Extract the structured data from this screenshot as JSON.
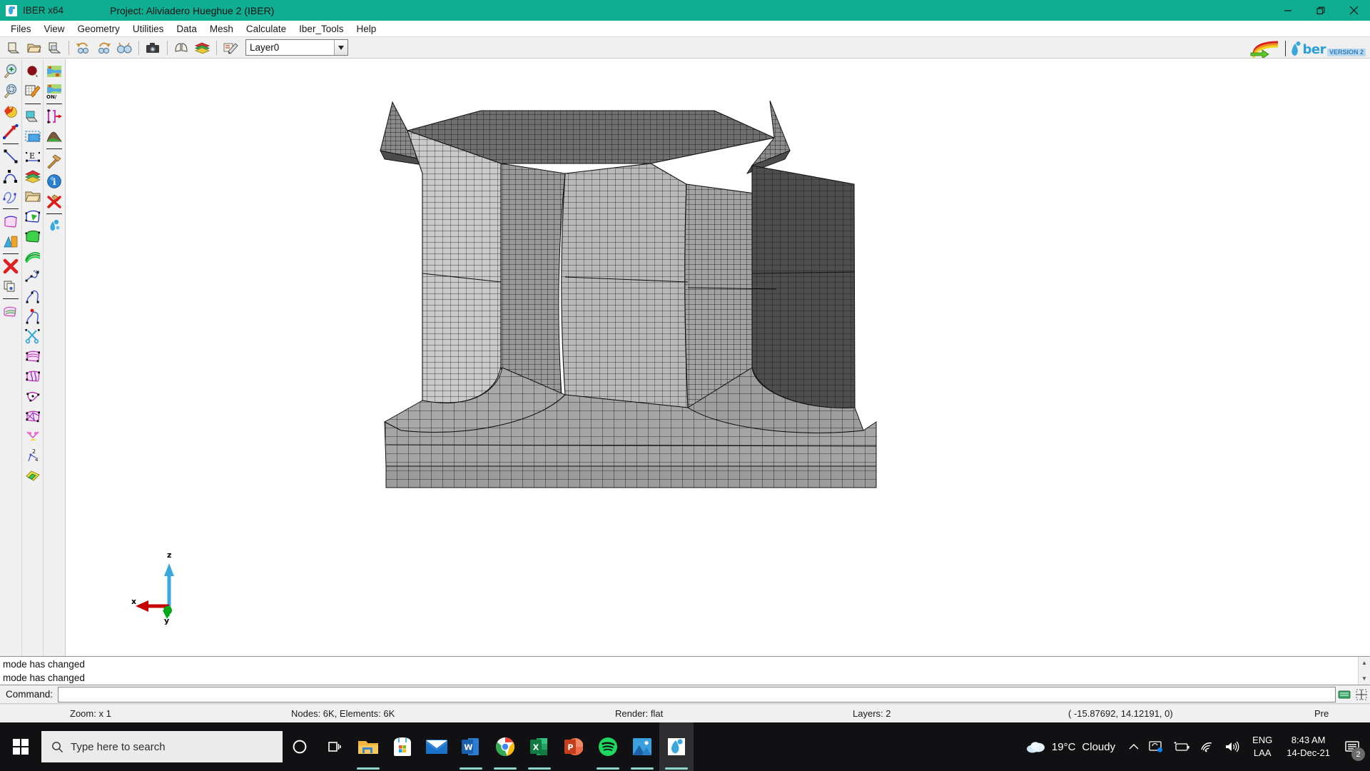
{
  "window": {
    "app_title": "IBER x64",
    "project_title": "Project: Aliviadero Hueghue 2 (IBER)",
    "minimize_label": "—",
    "maximize_label": "❐",
    "close_label": "✕",
    "titlebar_color": "#0fae93"
  },
  "menubar": {
    "items": [
      {
        "label": "Files"
      },
      {
        "label": "View"
      },
      {
        "label": "Geometry"
      },
      {
        "label": "Utilities"
      },
      {
        "label": "Data"
      },
      {
        "label": "Mesh"
      },
      {
        "label": "Calculate"
      },
      {
        "label": "Iber_Tools"
      },
      {
        "label": "Help"
      }
    ]
  },
  "toolbar": {
    "buttons": [
      {
        "name": "new-file-icon",
        "glyph": "◰"
      },
      {
        "name": "open-folder-icon",
        "glyph": "◱"
      },
      {
        "name": "save-disk-icon",
        "glyph": "▣"
      },
      {
        "name": "undo-icon",
        "glyph": "↶"
      },
      {
        "name": "redo-icon",
        "glyph": "↷"
      },
      {
        "name": "glasses-view-icon",
        "glyph": "⦿"
      },
      {
        "name": "camera-snapshot-icon",
        "glyph": "■"
      },
      {
        "name": "pages-icon",
        "glyph": "❐"
      },
      {
        "name": "layers-books-icon",
        "glyph": "☰"
      },
      {
        "name": "edit-pencil-icon",
        "glyph": "✎"
      }
    ],
    "layer_combo": {
      "value": "Layer0",
      "arrow": "▼"
    },
    "logo": {
      "rainbow_arrow": "rainbow-arrow-icon",
      "brand": "ber",
      "version": "VERSION 2"
    }
  },
  "sidebar": {
    "column1": [
      {
        "name": "zoom-in-icon"
      },
      {
        "name": "zoom-frame-icon"
      },
      {
        "name": "rotate-sphere-icon"
      },
      {
        "name": "arrow-point-icon"
      },
      {
        "sep": true
      },
      {
        "name": "line-icon"
      },
      {
        "name": "arc-icon"
      },
      {
        "name": "nurbs-curve-icon"
      },
      {
        "sep": true
      },
      {
        "name": "surface-icon"
      },
      {
        "name": "volume-icon"
      },
      {
        "sep": true
      },
      {
        "name": "delete-red-x-icon"
      },
      {
        "name": "copy-entity-icon"
      },
      {
        "sep": true
      },
      {
        "name": "mesh-surface-icon"
      }
    ],
    "column2": [
      {
        "name": "point-create-icon"
      },
      {
        "name": "edit-table-icon"
      },
      {
        "sep": true
      },
      {
        "name": "book-layer-icon"
      },
      {
        "name": "select-rect-icon"
      },
      {
        "name": "label-entity-icon"
      },
      {
        "name": "layers-stack-icon"
      },
      {
        "name": "open-folder-icon"
      },
      {
        "name": "triangle-mesh-icon"
      },
      {
        "name": "triangle-mesh-green-icon"
      },
      {
        "name": "contour-lines-icon"
      },
      {
        "name": "polyline-points-icon"
      },
      {
        "name": "nurbs-points-icon"
      },
      {
        "name": "nurbs-point-red-icon"
      },
      {
        "name": "scissors-cut-icon"
      },
      {
        "name": "structured-mesh-icon"
      },
      {
        "name": "unstructured-mesh-icon"
      },
      {
        "name": "surface-quad-icon"
      },
      {
        "name": "mesh-quality-icon"
      },
      {
        "name": "mesh-nodes-icon"
      },
      {
        "name": "mesh-numbering-icon"
      },
      {
        "name": "mesh-layers-icon"
      }
    ],
    "column3": [
      {
        "name": "terrain-map-icon"
      },
      {
        "name": "terrain-map-onoff-icon"
      },
      {
        "sep": true
      },
      {
        "name": "boundary-condition-icon"
      },
      {
        "name": "terrain-profile-icon"
      },
      {
        "sep": true
      },
      {
        "name": "hammer-build-icon"
      },
      {
        "name": "info-blue-icon"
      },
      {
        "name": "delete-hammer-icon"
      },
      {
        "sep": true
      },
      {
        "name": "water-drops-icon"
      }
    ]
  },
  "canvas": {
    "axis": {
      "x_label": "x",
      "y_label": "y",
      "z_label": "z",
      "x_color": "#c40000",
      "y_color": "#00a818",
      "z_color": "#3aa7dd"
    },
    "model_description": "3D structured finite-element mesh of a spillway (aliviadero), flat-shaded gray"
  },
  "messages": {
    "lines": [
      "mode has changed",
      "mode has changed"
    ],
    "scroll_up": "▲",
    "scroll_down": "▼"
  },
  "command": {
    "label": "Command:",
    "value": "",
    "placeholder": "",
    "icon1": "keyboard-icon",
    "icon2": "grid-icon"
  },
  "statusbar": {
    "zoom": "Zoom: x 1",
    "counts": "Nodes: 6K, Elements: 6K",
    "render": "Render: flat",
    "layers": "Layers: 2",
    "coordinates": "( -15.87692,  14.12191,  0)",
    "mode": "Pre"
  },
  "taskbar": {
    "start_name": "windows-start-icon",
    "search_placeholder": "Type here to search",
    "search_icon": "search-icon",
    "cortana_icon": "cortana-circle-icon",
    "taskview_icon": "task-view-icon",
    "apps": [
      {
        "name": "file-explorer-icon",
        "active": false,
        "running": true
      },
      {
        "name": "microsoft-store-icon",
        "active": false,
        "running": false
      },
      {
        "name": "mail-icon",
        "active": false,
        "running": false
      },
      {
        "name": "word-icon",
        "active": false,
        "running": true
      },
      {
        "name": "chrome-icon",
        "active": false,
        "running": true
      },
      {
        "name": "excel-icon",
        "active": false,
        "running": true
      },
      {
        "name": "powerpoint-icon",
        "active": false,
        "running": false
      },
      {
        "name": "spotify-icon",
        "active": false,
        "running": true
      },
      {
        "name": "photos-icon",
        "active": false,
        "running": true
      },
      {
        "name": "iber-icon",
        "active": true,
        "running": true
      }
    ],
    "weather": {
      "temp": "19°C",
      "condition": "Cloudy",
      "icon": "cloud-icon"
    },
    "tray": {
      "chevron": "∧",
      "onedrive_icon": "onedrive-sync-icon",
      "battery_icon": "battery-icon",
      "wifi_icon": "wifi-icon",
      "volume_icon": "speaker-icon"
    },
    "language": {
      "line1": "ENG",
      "line2": "LAA"
    },
    "clock": {
      "time": "8:43 AM",
      "date": "14-Dec-21"
    },
    "notifications": {
      "icon": "notification-icon",
      "count": "2"
    }
  }
}
